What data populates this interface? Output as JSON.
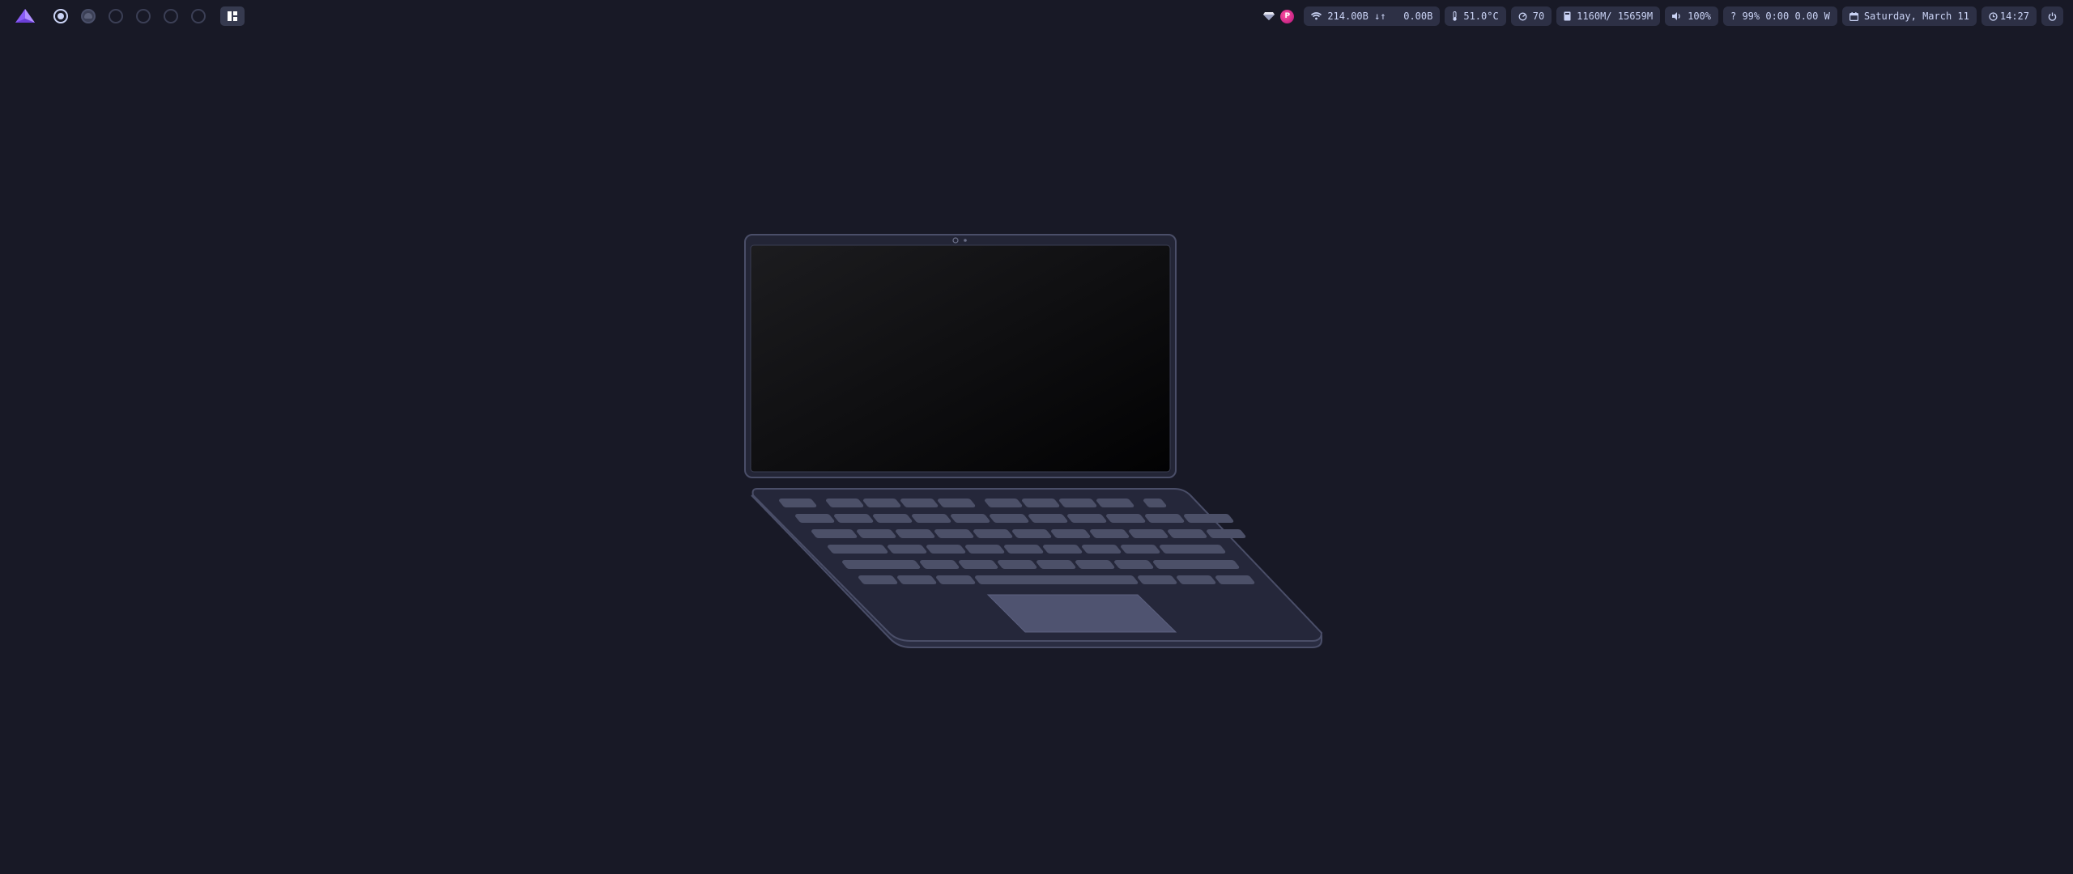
{
  "topbar": {
    "workspaces": [
      {
        "name": "workspace-1",
        "state": "active"
      },
      {
        "name": "workspace-2",
        "state": "occupied"
      },
      {
        "name": "workspace-3",
        "state": "empty"
      },
      {
        "name": "workspace-4",
        "state": "empty"
      },
      {
        "name": "workspace-5",
        "state": "empty"
      },
      {
        "name": "workspace-6",
        "state": "empty"
      }
    ],
    "tray": {
      "avatar_text": "P"
    },
    "network": {
      "icon": "wifi-icon",
      "text": "214.00B ↓↑   0.00B"
    },
    "temperature": {
      "icon": "thermometer-icon",
      "text": "51.0°C"
    },
    "cpu": {
      "icon": "cpu-icon",
      "text": "70"
    },
    "memory": {
      "icon": "memory-icon",
      "text": "1160M/ 15659M"
    },
    "volume": {
      "icon": "speaker-icon",
      "text": "100%"
    },
    "battery": {
      "text": "? 99% 0:00 0.00 W"
    },
    "date": {
      "icon": "calendar-icon",
      "text": "Saturday, March 11"
    },
    "clock": {
      "icon": "clock-icon",
      "text": "14:27"
    },
    "power": {
      "icon": "power-icon"
    }
  },
  "colors": {
    "background": "#181926",
    "pill": "#2d3045",
    "text": "#cad3f5",
    "accent_logo": "#8a5cf5"
  }
}
